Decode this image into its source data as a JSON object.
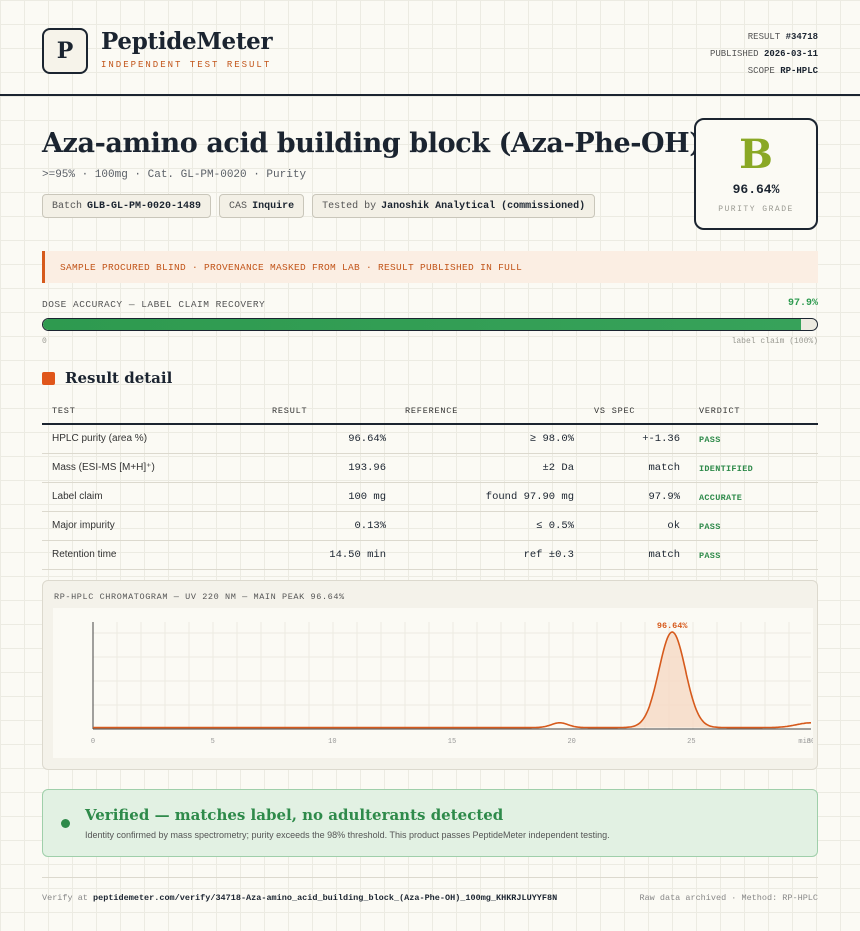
{
  "header": {
    "logo_letter": "P",
    "brand": "PeptideMeter",
    "brand_sub": "INDEPENDENT TEST RESULT",
    "result_label": "RESULT",
    "result_value": "#34718",
    "published_label": "PUBLISHED",
    "published_value": "2026-03-11",
    "scope_label": "SCOPE",
    "scope_value": "RP-HPLC"
  },
  "product": {
    "title": "Aza-amino acid building block (Aza-Phe-OH)",
    "subtitle": ">=95% · 100mg · Cat. GL-PM-0020 · Purity",
    "batch_label": "Batch",
    "batch_value": "GLB-GL-PM-0020-1489",
    "cas_label": "CAS",
    "cas_value": "Inquire",
    "tested_label": "Tested by",
    "tested_value": "Janoshik Analytical (commissioned)"
  },
  "grade": {
    "letter": "B",
    "percent": "96.64%",
    "label": "PURITY GRADE"
  },
  "notice": "SAMPLE PROCURED BLIND · PROVENANCE MASKED FROM LAB · RESULT PUBLISHED IN FULL",
  "dose": {
    "label": "DOSE ACCURACY — LABEL CLAIM RECOVERY",
    "value_text": "97.9%",
    "fraction": 0.979,
    "min_label": "0",
    "max_label": "label claim (100%)"
  },
  "section_title": "Result detail",
  "table": {
    "headers": [
      "TEST",
      "RESULT",
      "REFERENCE",
      "VS SPEC",
      "VERDICT"
    ],
    "rows": [
      {
        "test": "HPLC purity (area %)",
        "result": "96.64%",
        "reference": "≥ 98.0%",
        "vs": "+-1.36",
        "verdict": "PASS"
      },
      {
        "test": "Mass (ESI-MS [M+H]⁺)",
        "result": "193.96",
        "reference": "±2 Da",
        "vs": "match",
        "verdict": "IDENTIFIED"
      },
      {
        "test": "Label claim",
        "result": "100 mg",
        "reference": "found 97.90 mg",
        "vs": "97.9%",
        "verdict": "ACCURATE"
      },
      {
        "test": "Major impurity",
        "result": "0.13%",
        "reference": "≤ 0.5%",
        "vs": "ok",
        "verdict": "PASS"
      },
      {
        "test": "Retention time",
        "result": "14.50 min",
        "reference": "ref ±0.3",
        "vs": "match",
        "verdict": "PASS"
      }
    ]
  },
  "chart_data": {
    "type": "line",
    "title": "RP-HPLC CHROMATOGRAM — UV 220 NM — MAIN PEAK 96.64%",
    "xlabel": "",
    "ylabel": "",
    "x_ticks": [
      "0",
      "5",
      "10",
      "15",
      "20",
      "25",
      "30"
    ],
    "x_unit_label": "min",
    "xlim": [
      0,
      30
    ],
    "ylim": [
      0,
      1.12
    ],
    "baseline": 0.015,
    "peaks": [
      {
        "x": 19.5,
        "height": 0.05,
        "width": 0.35
      },
      {
        "x": 24.2,
        "height": 1.0,
        "width": 0.55,
        "label": "96.64%"
      },
      {
        "x": 30.0,
        "height": 0.05,
        "width": 0.6
      }
    ],
    "colors": {
      "line": "#d65a1c",
      "fill": "#f6d9c4"
    }
  },
  "verified": {
    "title": "Verified — matches label, no adulterants detected",
    "text": "Identity confirmed by mass spectrometry; purity exceeds the 98% threshold. This product passes PeptideMeter independent testing."
  },
  "footer": {
    "verify_prefix": "Verify at",
    "verify_url": "peptidemeter.com/verify/34718-Aza-amino_acid_building_block_(Aza-Phe-OH)_100mg_KHKRJLUYYF8N",
    "right": "Raw data archived · Method: RP-HPLC"
  }
}
